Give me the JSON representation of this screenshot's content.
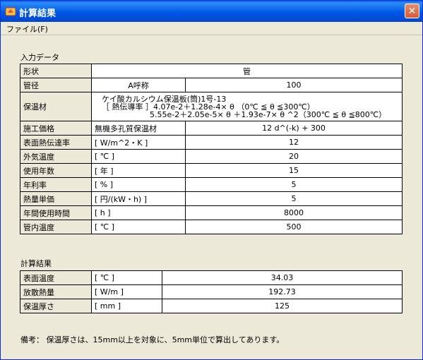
{
  "window": {
    "title": "計算結果"
  },
  "menu": {
    "file": "ファイル(F)"
  },
  "input_section": {
    "label": "入力データ",
    "rows": {
      "shape": {
        "label": "形状",
        "value": "管"
      },
      "diameter": {
        "label": "管径",
        "unit": "A呼称",
        "value": "100"
      },
      "insulation": {
        "label": "保温材",
        "line1": "ケイ酸カルシウム保温板(筒)1号-13",
        "line2": "［ 熱伝導率 ］4.07e-2＋1.28e-4× θ （0℃ ≦ θ ≦300℃）",
        "line3": "5.55e-2＋2.05e-5× θ ＋1.93e-7× θ ^2（300℃ ≦ θ ≦800℃）"
      },
      "cost": {
        "label": "施工価格",
        "unit": "無機多孔質保温材",
        "value": "12 d^(-k) + 300"
      },
      "heat_transfer": {
        "label": "表面熱伝達率",
        "unit": "[ W/m^2・K ]",
        "value": "12"
      },
      "ambient": {
        "label": "外気温度",
        "unit": "[ ℃ ]",
        "value": "20"
      },
      "years": {
        "label": "使用年数",
        "unit": "[ 年 ]",
        "value": "15"
      },
      "interest": {
        "label": "年利率",
        "unit": "[ % ]",
        "value": "5"
      },
      "heat_price": {
        "label": "熱量単価",
        "unit": "[ 円/(kW・h) ]",
        "value": "5"
      },
      "hours": {
        "label": "年間使用時間",
        "unit": "[ h ]",
        "value": "8000"
      },
      "pipe_temp": {
        "label": "管内温度",
        "unit": "[ ℃ ]",
        "value": "500"
      }
    }
  },
  "result_section": {
    "label": "計算結果",
    "rows": {
      "surface_temp": {
        "label": "表面温度",
        "unit": "[ ℃ ]",
        "value": "34.03"
      },
      "heat_loss": {
        "label": "放散熱量",
        "unit": "[ W/m ]",
        "value": "192.73"
      },
      "thickness": {
        "label": "保温厚さ",
        "unit": "[ mm ]",
        "value": "125"
      }
    }
  },
  "note": "備考： 保温厚さは、15mm以上を対象に、5mm単位で算出してあります。"
}
